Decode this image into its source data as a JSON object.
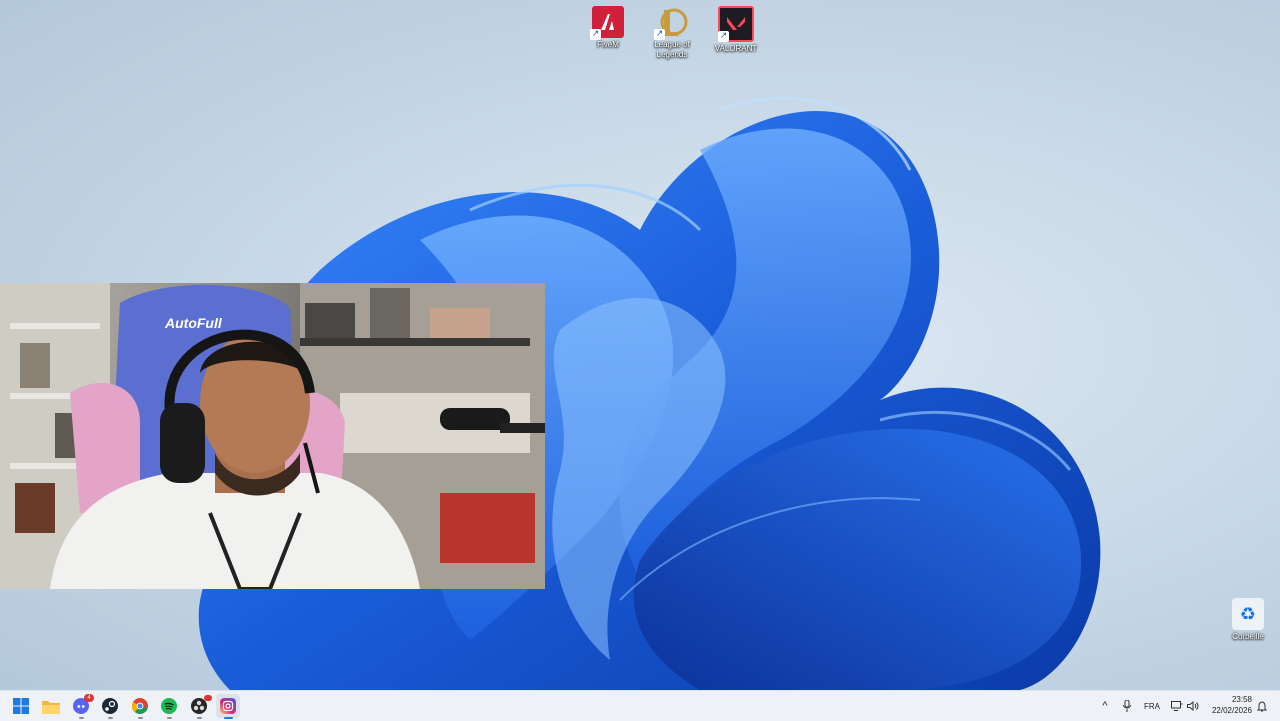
{
  "desktop": {
    "icons": [
      {
        "label": "FiveM",
        "icon": "fivem-icon"
      },
      {
        "label": "League of Legends",
        "icon": "league-of-legends-icon"
      },
      {
        "label": "VALORANT",
        "icon": "valorant-icon"
      },
      {
        "label": "Corbeille",
        "icon": "recycle-bin-icon"
      }
    ]
  },
  "webcam": {
    "chair_text": "AutoFull"
  },
  "taskbar": {
    "apps": [
      {
        "name": "start",
        "icon": "windows-start-icon"
      },
      {
        "name": "file-explorer",
        "icon": "folder-icon"
      },
      {
        "name": "discord",
        "icon": "discord-icon",
        "badge": "4"
      },
      {
        "name": "steam",
        "icon": "steam-icon"
      },
      {
        "name": "chrome",
        "icon": "chrome-icon"
      },
      {
        "name": "spotify",
        "icon": "spotify-icon"
      },
      {
        "name": "obs",
        "icon": "obs-icon"
      },
      {
        "name": "instagram",
        "icon": "instagram-icon"
      }
    ],
    "tray": {
      "chevron": "^",
      "language": "FRA",
      "time": "23:58",
      "date": "22/02/2026"
    }
  },
  "colors": {
    "accent": "#1a5cd8",
    "taskbar": "#eef1f6"
  }
}
